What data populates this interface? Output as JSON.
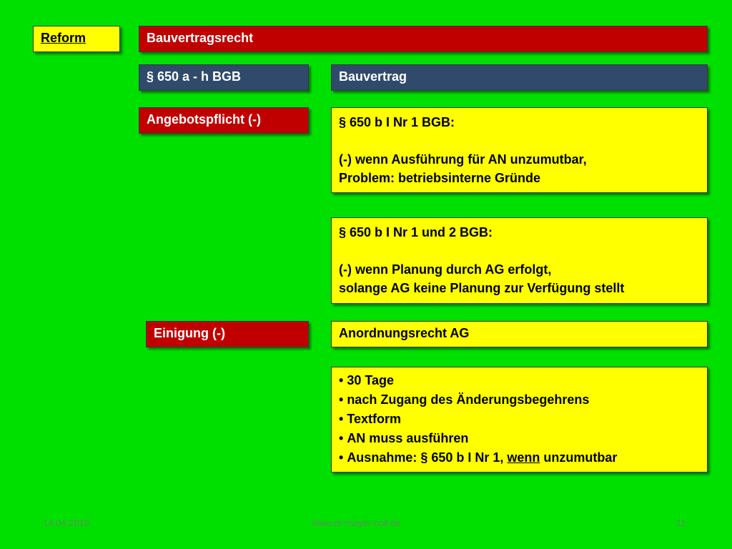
{
  "header": {
    "tag": "Reform",
    "title": "Bauvertragsrecht"
  },
  "row1": {
    "left": "§ 650 a - h BGB",
    "right": "Bauvertrag"
  },
  "row2": {
    "left": "Angebotspflicht (-)",
    "right_lines": [
      "§ 650 b I Nr 1 BGB:",
      "",
      "(-) wenn  Ausführung für AN unzumutbar,",
      "Problem: betriebsinterne Gründe"
    ]
  },
  "row3": {
    "right_lines": [
      "§ 650 b I Nr 1 und 2 BGB:",
      "",
      "(-) wenn  Planung durch AG erfolgt,",
      "solange AG keine Planung zur Verfügung stellt"
    ]
  },
  "row4": {
    "left": "Einigung (-)",
    "right": "Anordnungsrecht AG"
  },
  "bullets": {
    "items": [
      "30 Tage",
      "nach Zugang des Änderungsbegehrens",
      "Textform",
      "AN muss ausführen"
    ],
    "last_prefix": "Ausnahme: § 650 b I Nr 1, ",
    "last_underlined": "wenn",
    "last_suffix": " unzumutbar"
  },
  "footer": {
    "date": "14.04.2019",
    "website": "www.dr-mayer-coll.de",
    "page": "11"
  },
  "colors": {
    "background": "#00e000",
    "red": "#c00000",
    "navy": "#2f4a6b",
    "yellow": "#ffff00"
  }
}
